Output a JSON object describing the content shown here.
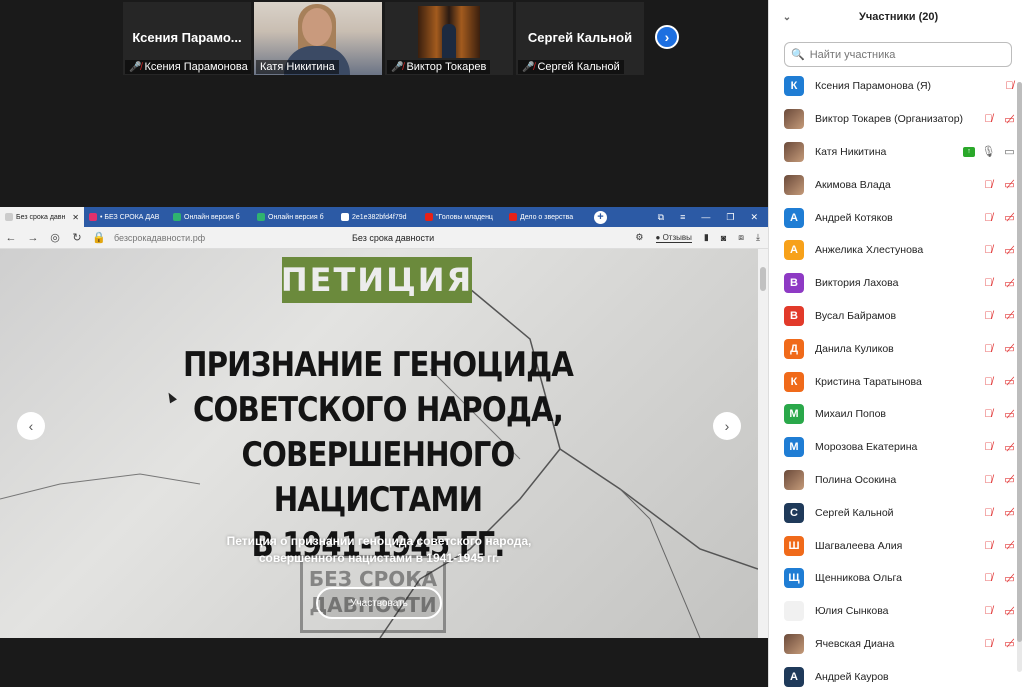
{
  "meeting": {
    "tiles": [
      {
        "big_name": "Ксения Парамо...",
        "label": "Ксения Парамонова",
        "muted": true
      },
      {
        "big_name": "",
        "label": "Катя Никитина",
        "muted": false
      },
      {
        "big_name": "",
        "label": "Виктор Токарев",
        "muted": true
      },
      {
        "big_name": "Сергей Кальной",
        "label": "Сергей Кальной",
        "muted": true
      }
    ]
  },
  "browser": {
    "tabs": [
      {
        "label": "Без срока давн",
        "color": "#cccccc"
      },
      {
        "label": "• БЕЗ СРОКА ДАВ",
        "color": "#e1306c"
      },
      {
        "label": "Онлайн версия б",
        "color": "#2fb36f"
      },
      {
        "label": "Онлайн версия б",
        "color": "#2fb36f"
      },
      {
        "label": "2e1e382bfd4f79d",
        "color": "#ffffff"
      },
      {
        "label": "\"Головы младенц",
        "color": "#e62117"
      },
      {
        "label": "Дело о зверства",
        "color": "#e62117"
      }
    ],
    "url": "безсрокадавности.рф",
    "page_title": "Без срока давности",
    "reviews_label": "Отзывы",
    "hero": {
      "badge": "ПЕТИЦИЯ",
      "headline": [
        "ПРИЗНАНИЕ ГЕНОЦИДА",
        "СОВЕТСКОГО НАРОДА,",
        "СОВЕРШЕННОГО НАЦИСТАМИ",
        "В 1941-1945 ГГ."
      ],
      "subtitle": "Петиция о признании геноцида советского народа, совершенного нацистами в 1941-1945 гг.",
      "stamp": [
        "БЕЗ СРОКА",
        "ДАВНОСТИ"
      ],
      "cta": "Участвовать"
    }
  },
  "panel": {
    "title": "Участники (20)",
    "search_placeholder": "Найти участника",
    "participants": [
      {
        "name": "Ксения Парамонова (Я)",
        "initial": "К",
        "color": "#1f7dd4",
        "icons": "mic-off"
      },
      {
        "name": "Виктор Токарев (Организатор)",
        "initial": "",
        "color": "#6a4a2a",
        "icons": "both-off",
        "photo": true
      },
      {
        "name": "Катя Никитина",
        "initial": "",
        "color": "#c59b7a",
        "icons": "share-on",
        "photo": true
      },
      {
        "name": "Акимова Влада",
        "initial": "",
        "color": "#8a7a6a",
        "icons": "both-off",
        "photo": true
      },
      {
        "name": "Андрей Котяков",
        "initial": "А",
        "color": "#1f7dd4",
        "icons": "both-off"
      },
      {
        "name": "Анжелика Хлестунова",
        "initial": "А",
        "color": "#f7a11a",
        "icons": "both-off"
      },
      {
        "name": "Виктория Лахова",
        "initial": "В",
        "color": "#8e3ac4",
        "icons": "both-off"
      },
      {
        "name": "Вусал Байрамов",
        "initial": "В",
        "color": "#e23a2a",
        "icons": "both-off"
      },
      {
        "name": "Данила Куликов",
        "initial": "Д",
        "color": "#f06a1a",
        "icons": "both-off"
      },
      {
        "name": "Кристина Таратынова",
        "initial": "К",
        "color": "#f06a1a",
        "icons": "both-off"
      },
      {
        "name": "Михаил Попов",
        "initial": "М",
        "color": "#2aa84a",
        "icons": "both-off"
      },
      {
        "name": "Морозова Екатерина",
        "initial": "М",
        "color": "#1f7dd4",
        "icons": "both-off"
      },
      {
        "name": "Полина Осокина",
        "initial": "",
        "color": "#5a4a5a",
        "icons": "both-off",
        "photo": true
      },
      {
        "name": "Сергей Кальной",
        "initial": "С",
        "color": "#1f3a5a",
        "icons": "both-off"
      },
      {
        "name": "Шагвалеева Алия",
        "initial": "Ш",
        "color": "#f06a1a",
        "icons": "both-off"
      },
      {
        "name": "Щенникова Ольга",
        "initial": "Щ",
        "color": "#1f7dd4",
        "icons": "both-off"
      },
      {
        "name": "Юлия Сынкова",
        "initial": "",
        "color": "#f1f1f1",
        "icons": "both-off",
        "blank": true
      },
      {
        "name": "Ячевская Диана",
        "initial": "",
        "color": "#d98a3a",
        "icons": "both-off",
        "photo": true
      },
      {
        "name": "Андрей Кауров",
        "initial": "А",
        "color": "#1f3a5a",
        "icons": ""
      }
    ]
  }
}
